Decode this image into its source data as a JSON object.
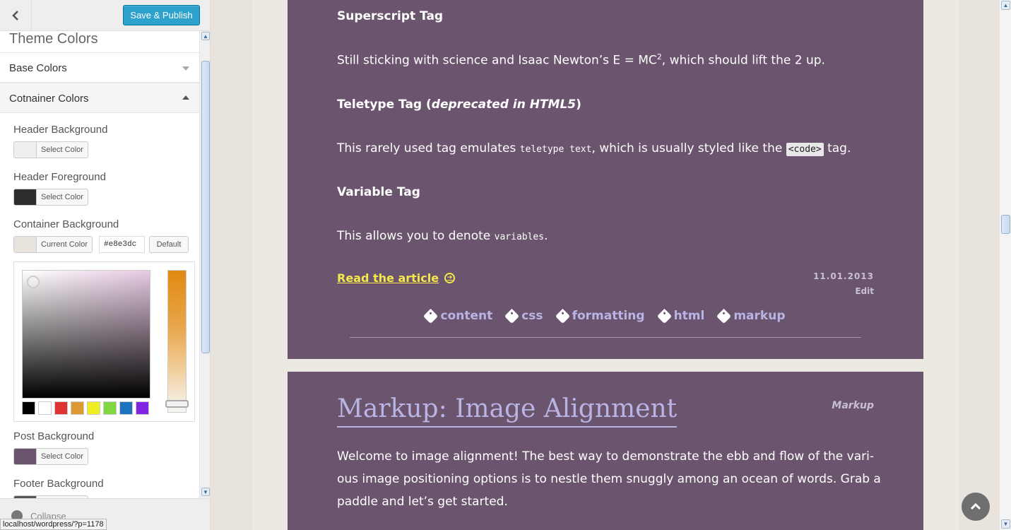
{
  "sidebar": {
    "save_label": "Save & Publish",
    "section_title": "Theme Colors",
    "base_colors_label": "Base Colors",
    "container_colors_label": "Cotnainer Colors",
    "controls": {
      "header_bg": {
        "label": "Header Background",
        "button": "Select Color",
        "color": "#efefef"
      },
      "header_fg": {
        "label": "Header Foreground",
        "button": "Select Color",
        "color": "#2d2d2d"
      },
      "container_bg": {
        "label": "Container Background",
        "button": "Current Color",
        "color": "#e8e3dc",
        "hex_value": "#e8e3dc",
        "default_label": "Default"
      },
      "post_bg": {
        "label": "Post Background",
        "button": "Select Color",
        "color": "#6b546d"
      },
      "footer_bg": {
        "label": "Footer Background"
      }
    },
    "palette": [
      "#000000",
      "#ffffff",
      "#dd3333",
      "#dd9933",
      "#eeee22",
      "#81d742",
      "#1e73be",
      "#8224e3"
    ],
    "collapse_label": "Collapse"
  },
  "status_url": "localhost/wordpress/?p=1178",
  "post1": {
    "superscript_heading": "Superscript Tag",
    "superscript_text_pre": "Still sticking with science and Isaac Newton’s E = MC",
    "superscript_sup": "2",
    "superscript_text_post": ", which should lift the 2 up.",
    "teletype_heading_pre": "Teletype Tag (",
    "teletype_heading_em": "deprecated in HTML5",
    "teletype_heading_post": ")",
    "teletype_text_pre": "This rarely used tag emulates ",
    "teletype_code": "teletype text",
    "teletype_text_mid": ", which is usually styled like the ",
    "teletype_code2": "<code>",
    "teletype_text_post": " tag.",
    "variable_heading": "Variable Tag",
    "variable_text_pre": "This allows you to denote ",
    "variable_code": "variables",
    "variable_text_post": ".",
    "read_more": "Read the article",
    "date": "11.01.2013",
    "edit": "Edit",
    "tags": [
      "content",
      "css",
      "formatting",
      "html",
      "markup"
    ]
  },
  "post2": {
    "title": "Markup: Image Alignment",
    "category": "Markup",
    "body": "Welcome to image alignment! The best way to demonstrate the ebb and flow of the vari-ous image positioning options is to nestle them snuggly among an ocean of words. Grab a paddle and let’s get started."
  },
  "icons": {
    "back": "chevron-left-icon",
    "read_more": "arrow-circle-right-icon",
    "tag": "tag-icon",
    "to_top": "chevron-up-icon"
  }
}
